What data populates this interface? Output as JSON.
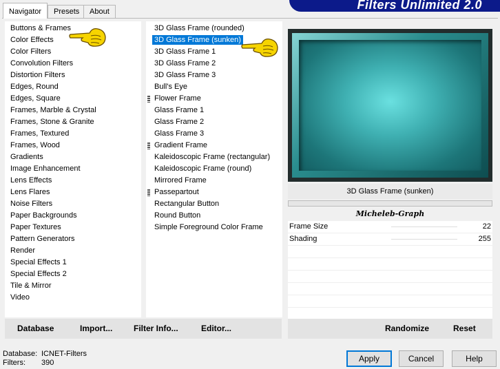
{
  "tabs": [
    {
      "label": "Navigator"
    },
    {
      "label": "Presets"
    },
    {
      "label": "About"
    }
  ],
  "banner_title": "Filters Unlimited 2.0",
  "categories": [
    "Buttons & Frames",
    "Color Effects",
    "Color Filters",
    "Convolution Filters",
    "Distortion Filters",
    "Edges, Round",
    "Edges, Square",
    "Frames, Marble & Crystal",
    "Frames, Stone & Granite",
    "Frames, Textured",
    "Frames, Wood",
    "Gradients",
    "Image Enhancement",
    "Lens Effects",
    "Lens Flares",
    "Noise Filters",
    "Paper Backgrounds",
    "Paper Textures",
    "Pattern Generators",
    "Render",
    "Special Effects 1",
    "Special Effects 2",
    "Tile & Mirror",
    "Video"
  ],
  "filters": [
    "3D Glass Frame (rounded)",
    "3D Glass Frame (sunken)",
    "3D Glass Frame 1",
    "3D Glass Frame 2",
    "3D Glass Frame 3",
    "Bull's Eye",
    "Flower Frame",
    "Glass Frame 1",
    "Glass Frame 2",
    "Glass Frame 3",
    "Gradient Frame",
    "Kaleidoscopic Frame (rectangular)",
    "Kaleidoscopic Frame (round)",
    "Mirrored Frame",
    "Passepartout",
    "Rectangular Button",
    "Round Button",
    "Simple Foreground Color Frame"
  ],
  "selected_filter_name": "3D Glass Frame (sunken)",
  "author": "Micheleb-Graph",
  "params": [
    {
      "label": "Frame Size",
      "value": "22"
    },
    {
      "label": "Shading",
      "value": "255"
    }
  ],
  "left_buttons": {
    "database": "Database",
    "import": "Import...",
    "filter_info": "Filter Info...",
    "editor": "Editor..."
  },
  "right_buttons": {
    "randomize": "Randomize",
    "reset": "Reset"
  },
  "status": {
    "database_label": "Database:",
    "database_value": "ICNET-Filters",
    "filters_label": "Filters:",
    "filters_value": "390"
  },
  "dialog_buttons": {
    "apply": "Apply",
    "cancel": "Cancel",
    "help": "Help"
  },
  "icons": [
    "pointing-hand-icon",
    "grip-icon"
  ],
  "colors": {
    "selection": "#0078d7",
    "banner": "#0c1a8a",
    "preview_teal": "#3fb0b2"
  }
}
